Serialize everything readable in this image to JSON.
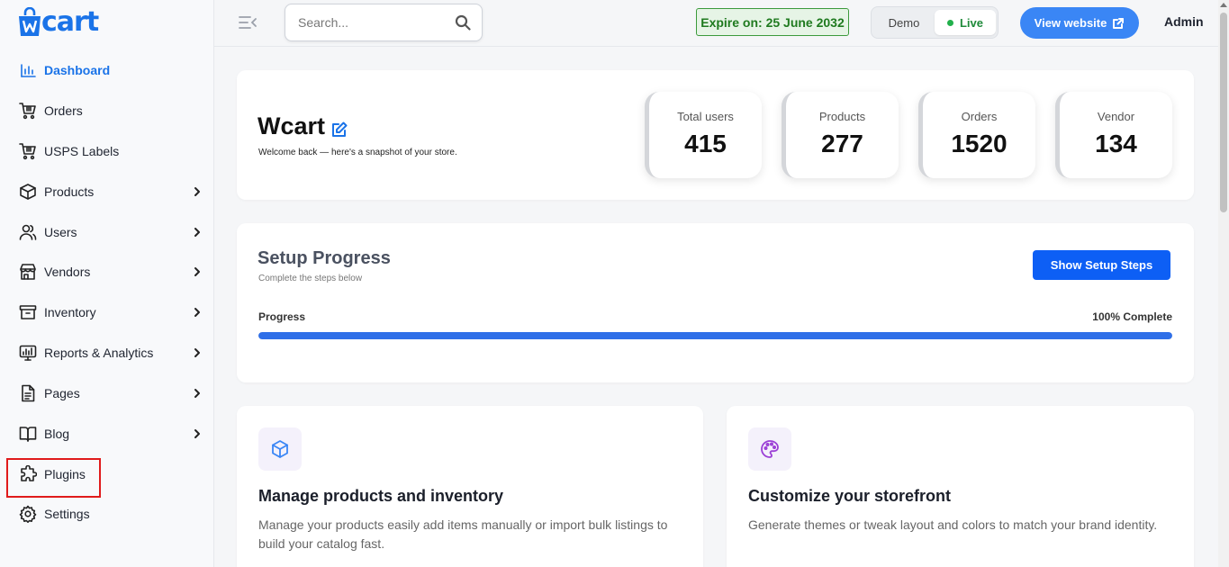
{
  "brand": {
    "name": "Wcart",
    "logo_rest": "cart"
  },
  "colors": {
    "accent": "#1a73e8",
    "live": "#22b04b",
    "expire_bg": "#e6f4e6",
    "highlight": "#e01b1b",
    "button": "#0d5ff5",
    "progress": "#2f6fe8"
  },
  "sidebar": {
    "items": [
      {
        "label": "Dashboard",
        "icon": "bar-chart-icon",
        "active": true,
        "has_submenu": false
      },
      {
        "label": "Orders",
        "icon": "cart-icon",
        "active": false,
        "has_submenu": false
      },
      {
        "label": "USPS Labels",
        "icon": "cart-label-icon",
        "active": false,
        "has_submenu": false
      },
      {
        "label": "Products",
        "icon": "box-icon",
        "active": false,
        "has_submenu": true
      },
      {
        "label": "Users",
        "icon": "users-icon",
        "active": false,
        "has_submenu": true
      },
      {
        "label": "Vendors",
        "icon": "store-icon",
        "active": false,
        "has_submenu": true
      },
      {
        "label": "Inventory",
        "icon": "archive-icon",
        "active": false,
        "has_submenu": true
      },
      {
        "label": "Reports & Analytics",
        "icon": "monitor-chart-icon",
        "active": false,
        "has_submenu": true
      },
      {
        "label": "Pages",
        "icon": "file-icon",
        "active": false,
        "has_submenu": true
      },
      {
        "label": "Blog",
        "icon": "book-open-icon",
        "active": false,
        "has_submenu": true
      },
      {
        "label": "Plugins",
        "icon": "puzzle-icon",
        "active": false,
        "has_submenu": false,
        "highlighted": true
      },
      {
        "label": "Settings",
        "icon": "gear-icon",
        "active": false,
        "has_submenu": false
      }
    ]
  },
  "topbar": {
    "search_placeholder": "Search...",
    "expire_text": "Expire on: 25 June 2032",
    "mode_demo": "Demo",
    "mode_live": "Live",
    "mode_selected": "Live",
    "view_website": "View website",
    "user": "Admin"
  },
  "hero": {
    "title": "Wcart",
    "welcome": "Welcome back — here's a snapshot of your store.",
    "stats": [
      {
        "label": "Total users",
        "value": "415"
      },
      {
        "label": "Products",
        "value": "277"
      },
      {
        "label": "Orders",
        "value": "1520"
      },
      {
        "label": "Vendor",
        "value": "134"
      }
    ]
  },
  "setup": {
    "title": "Setup Progress",
    "subtitle": "Complete the steps below",
    "button": "Show Setup Steps",
    "progress_label": "Progress",
    "progress_text": "100% Complete",
    "progress_value": 100
  },
  "features": [
    {
      "icon": "cube-icon",
      "icon_color": "#3a86f5",
      "title": "Manage products and inventory",
      "description": "Manage your products easily add items manually or import bulk listings to build your catalog fast."
    },
    {
      "icon": "palette-icon",
      "icon_color": "#9b3fd6",
      "title": "Customize your storefront",
      "description": "Generate themes or tweak layout and colors to match your brand identity."
    }
  ]
}
